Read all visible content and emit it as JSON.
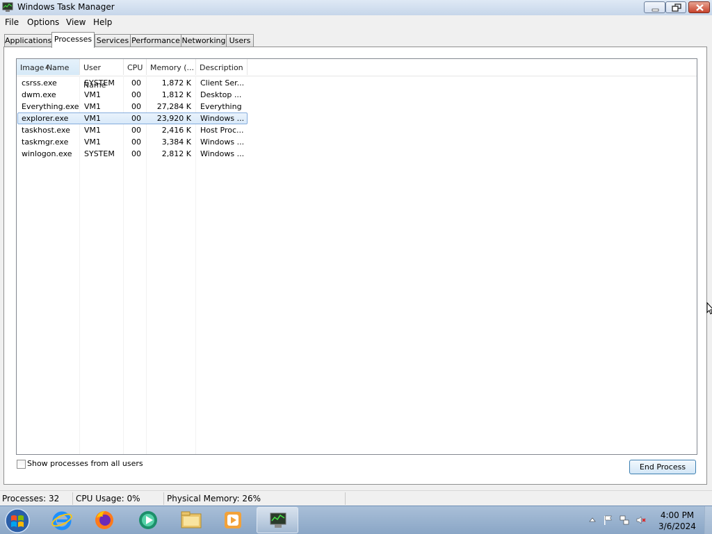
{
  "window": {
    "title": "Windows Task Manager"
  },
  "menu": [
    {
      "label": "File"
    },
    {
      "label": "Options"
    },
    {
      "label": "View"
    },
    {
      "label": "Help"
    }
  ],
  "tabs": [
    {
      "label": "Applications"
    },
    {
      "label": "Processes",
      "active": true
    },
    {
      "label": "Services"
    },
    {
      "label": "Performance"
    },
    {
      "label": "Networking"
    },
    {
      "label": "Users"
    }
  ],
  "columns": [
    "Image Name",
    "User Name",
    "CPU",
    "Memory (...",
    "Description"
  ],
  "processes": [
    {
      "image": "csrss.exe",
      "user": "SYSTEM",
      "cpu": "00",
      "memory": "1,872 K",
      "desc": "Client Ser..."
    },
    {
      "image": "dwm.exe",
      "user": "VM1",
      "cpu": "00",
      "memory": "1,812 K",
      "desc": "Desktop ..."
    },
    {
      "image": "Everything.exe",
      "user": "VM1",
      "cpu": "00",
      "memory": "27,284 K",
      "desc": "Everything"
    },
    {
      "image": "explorer.exe",
      "user": "VM1",
      "cpu": "00",
      "memory": "23,920 K",
      "desc": "Windows ...",
      "selected": true
    },
    {
      "image": "taskhost.exe",
      "user": "VM1",
      "cpu": "00",
      "memory": "2,416 K",
      "desc": "Host Proc..."
    },
    {
      "image": "taskmgr.exe",
      "user": "VM1",
      "cpu": "00",
      "memory": "3,384 K",
      "desc": "Windows ..."
    },
    {
      "image": "winlogon.exe",
      "user": "SYSTEM",
      "cpu": "00",
      "memory": "2,812 K",
      "desc": "Windows ..."
    }
  ],
  "show_all_label": "Show processes from all users",
  "show_all_checked": false,
  "end_process_label": "End Process",
  "status": {
    "processes": "Processes: 32",
    "cpu": "CPU Usage: 0%",
    "memory": "Physical Memory: 26%"
  },
  "taskbar": {
    "pinned": [
      "internet-explorer-icon",
      "firefox-icon",
      "media-center-icon",
      "file-explorer-icon",
      "media-player-icon",
      "task-manager-icon"
    ],
    "clock_time": "4:00 PM",
    "clock_date": "3/6/2024"
  },
  "colors": {
    "selection": "#cce4f7",
    "taskbar": "#9cb6d3"
  }
}
